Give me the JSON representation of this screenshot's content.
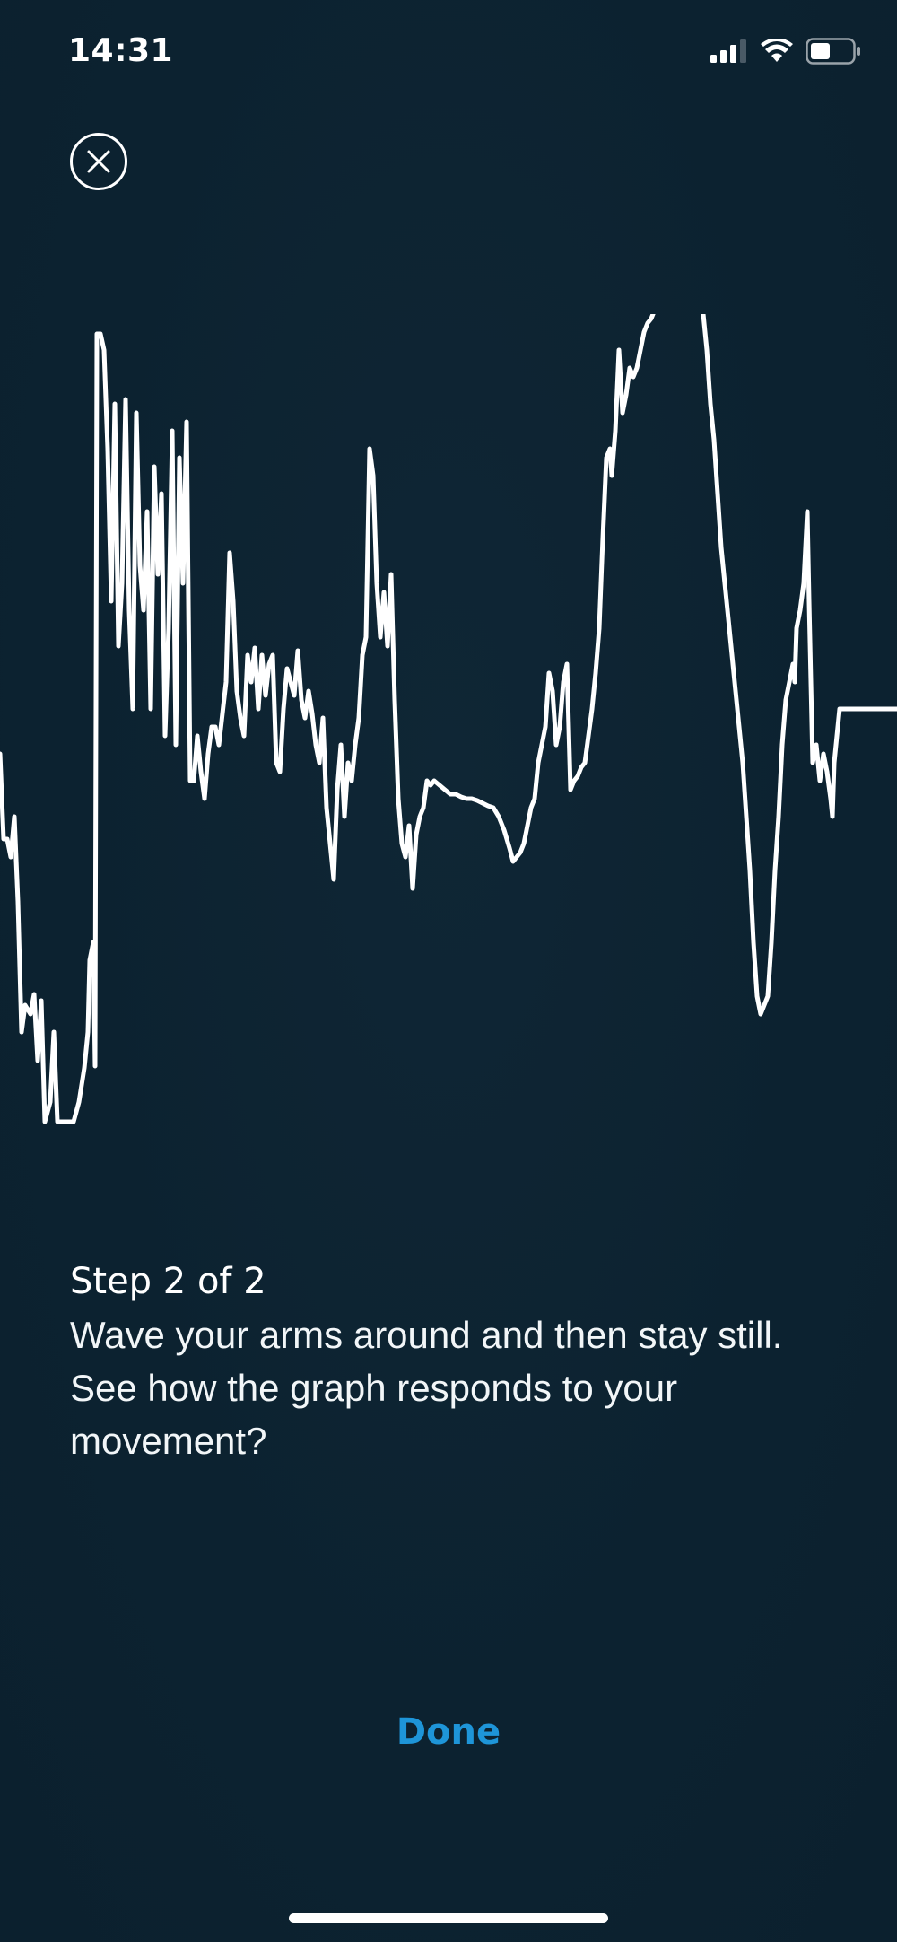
{
  "status_bar": {
    "time": "14:31",
    "icons": [
      "cellular-signal-icon",
      "wifi-icon",
      "battery-icon"
    ]
  },
  "close": {
    "icon": "close-icon"
  },
  "graph": {
    "line_color": "#ffffff"
  },
  "instructions": {
    "step_label": "Step 2 of 2",
    "line1": "Wave your arms around and then stay still.",
    "line2": "See how the graph responds to your",
    "line3": "movement?"
  },
  "actions": {
    "done_label": "Done",
    "done_color": "#1e95d8"
  },
  "colors": {
    "background": "#0c2231",
    "text": "#ffffff"
  }
}
